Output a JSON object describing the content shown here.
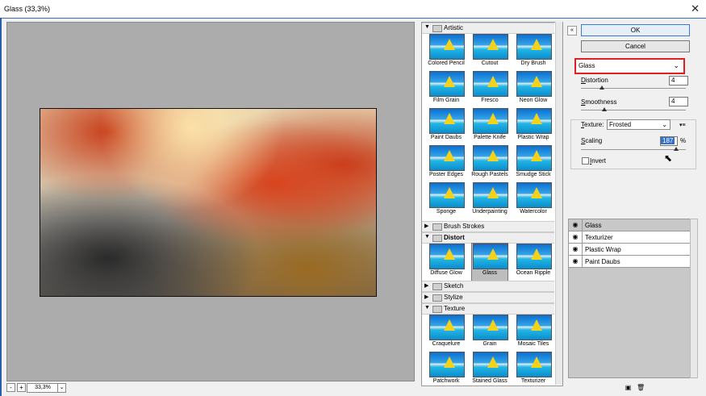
{
  "window": {
    "title": "Glass (33,3%)",
    "close_glyph": "✕"
  },
  "preview": {
    "zoom": "33,3%",
    "minus": "-",
    "plus": "+",
    "dropdown": "⌄"
  },
  "gallery": {
    "categories": [
      {
        "label": "Artistic",
        "expanded": true,
        "filters": [
          "Colored Pencil",
          "Cutout",
          "Dry Brush",
          "Film Grain",
          "Fresco",
          "Neon Glow",
          "Paint Daubs",
          "Palette Knife",
          "Plastic Wrap",
          "Poster Edges",
          "Rough Pastels",
          "Smudge Stick",
          "Sponge",
          "Underpainting",
          "Watercolor"
        ]
      },
      {
        "label": "Brush Strokes",
        "expanded": false
      },
      {
        "label": "Distort",
        "expanded": true,
        "bold": true,
        "filters": [
          "Diffuse Glow",
          "Glass",
          "Ocean Ripple"
        ],
        "selected": "Glass"
      },
      {
        "label": "Sketch",
        "expanded": false
      },
      {
        "label": "Stylize",
        "expanded": false
      },
      {
        "label": "Texture",
        "expanded": true,
        "filters": [
          "Craquelure",
          "Grain",
          "Mosaic Tiles",
          "Patchwork",
          "Stained Glass",
          "Texturizer"
        ]
      }
    ]
  },
  "controls": {
    "ok": "OK",
    "cancel": "Cancel",
    "collapse": "«",
    "filter": "Glass",
    "distortion": {
      "label_u": "D",
      "label_rest": "istortion",
      "value": "4"
    },
    "smoothness": {
      "label_u": "S",
      "label_rest": "moothness",
      "value": "4"
    },
    "texture": {
      "label_u": "T",
      "label_rest": "exture:",
      "value": "Frosted"
    },
    "scaling": {
      "label_u": "S",
      "label_rest": "caling",
      "value": "187",
      "unit": "%"
    },
    "invert": {
      "label_u": "I",
      "label_rest": "nvert",
      "checked": false
    }
  },
  "layers": {
    "items": [
      "Glass",
      "Texturizer",
      "Plastic Wrap",
      "Paint Daubs"
    ],
    "selected": "Glass",
    "eye_glyph": "◉"
  },
  "colors": {
    "highlight": "#e02020",
    "selection": "#3470c6"
  }
}
